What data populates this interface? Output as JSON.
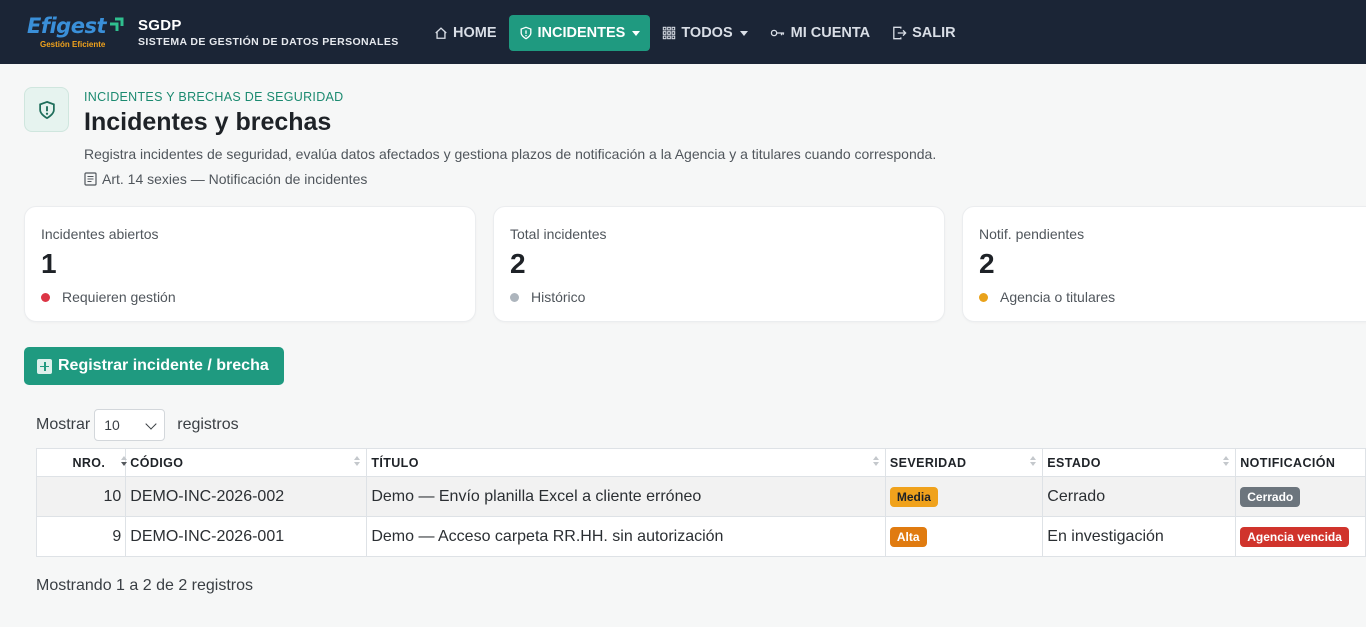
{
  "brand": {
    "logo_text": "Efigest",
    "logo_tagline": "Gestión Eficiente",
    "name": "SGDP",
    "subtitle": "SISTEMA DE GESTIÓN DE DATOS PERSONALES"
  },
  "nav": {
    "items": [
      {
        "label": "HOME",
        "icon": "home-icon",
        "active": false,
        "dropdown": false
      },
      {
        "label": "INCIDENTES",
        "icon": "shield-icon",
        "active": true,
        "dropdown": true
      },
      {
        "label": "TODOS",
        "icon": "grid-icon",
        "active": false,
        "dropdown": true
      },
      {
        "label": "MI CUENTA",
        "icon": "key-icon",
        "active": false,
        "dropdown": false
      },
      {
        "label": "SALIR",
        "icon": "logout-icon",
        "active": false,
        "dropdown": false
      }
    ]
  },
  "header": {
    "kicker": "INCIDENTES Y BRECHAS DE SEGURIDAD",
    "title": "Incidentes y brechas",
    "description": "Registra incidentes de seguridad, evalúa datos afectados y gestiona plazos de notificación a la Agencia y a titulares cuando corresponda.",
    "article": "Art. 14 sexies — Notificación de incidentes",
    "icon": "shield-alert-icon"
  },
  "stats": [
    {
      "label": "Incidentes abiertos",
      "value": "1",
      "note": "Requieren gestión",
      "dot_color": "#dc3545"
    },
    {
      "label": "Total incidentes",
      "value": "2",
      "note": "Histórico",
      "dot_color": "#adb5bd"
    },
    {
      "label": "Notif. pendientes",
      "value": "2",
      "note": "Agencia o titulares",
      "dot_color": "#e9a21b"
    }
  ],
  "register_button": {
    "label": "Registrar incidente / brecha"
  },
  "length": {
    "prefix": "Mostrar",
    "value": "10",
    "suffix": "registros"
  },
  "table": {
    "columns": [
      "NRO.",
      "CÓDIGO",
      "TÍTULO",
      "SEVERIDAD",
      "ESTADO",
      "NOTIFICACIÓN"
    ],
    "rows": [
      {
        "nro": "10",
        "codigo": "DEMO-INC-2026-002",
        "titulo": "Demo — Envío planilla Excel a cliente erróneo",
        "severidad": "Media",
        "severidad_color": "#f0a21c",
        "severidad_text": "#1e2227",
        "estado": "Cerrado",
        "notificacion": "Cerrado",
        "notificacion_color": "#6c757d"
      },
      {
        "nro": "9",
        "codigo": "DEMO-INC-2026-001",
        "titulo": "Demo — Acceso carpeta RR.HH. sin autorización",
        "severidad": "Alta",
        "severidad_color": "#e07b10",
        "severidad_text": "#ffffff",
        "estado": "En investigación",
        "notificacion": "Agencia vencida",
        "notificacion_color": "#d0342c"
      }
    ]
  },
  "info": "Mostrando 1 a 2 de 2 registros",
  "colors": {
    "accent": "#1f9a80",
    "navbar": "#1b2536"
  }
}
